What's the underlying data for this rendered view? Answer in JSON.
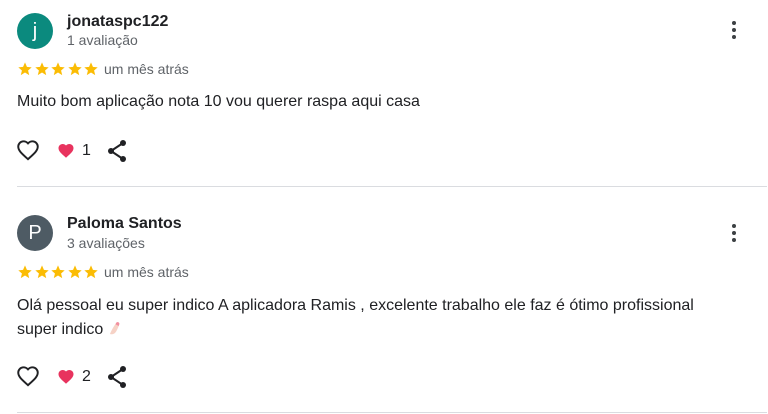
{
  "reviews": [
    {
      "avatar_letter": "j",
      "avatar_color": "#0b8a7e",
      "name": "jonataspc122",
      "review_count": "1 avaliação",
      "rating": 5,
      "date": "um mês atrás",
      "text": "Muito bom aplicação nota 10 vou querer raspa aqui casa",
      "likes": "1",
      "icons": {
        "menu": "more-vert-icon",
        "like": "heart-outline-icon",
        "badge": "heart-filled-icon",
        "share": "share-icon"
      }
    },
    {
      "avatar_letter": "P",
      "avatar_color": "#4e5b64",
      "name": "Paloma Santos",
      "review_count": "3 avaliações",
      "rating": 5,
      "date": "um mês atrás",
      "text": "Olá pessoal eu super indico A aplicadora Ramis , excelente trabalho ele faz é ótimo profissional super indico",
      "text_emoji": "nail-polish-emoji",
      "likes": "2",
      "icons": {
        "menu": "more-vert-icon",
        "like": "heart-outline-icon",
        "badge": "heart-filled-icon",
        "share": "share-icon"
      }
    }
  ],
  "colors": {
    "star": "#fbbc04",
    "heart": "#e8335e",
    "secondary_text": "#5f6368",
    "divider": "#dadce0"
  }
}
